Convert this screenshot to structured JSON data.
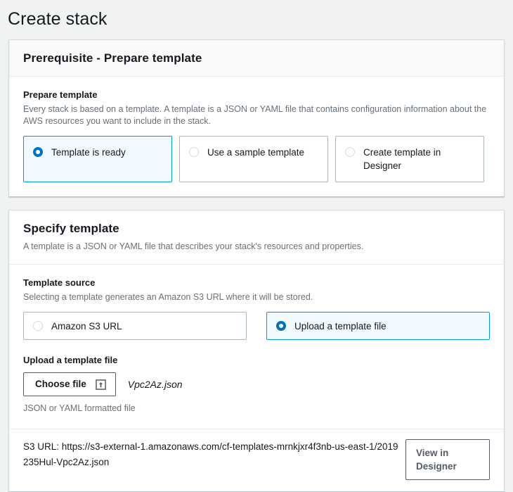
{
  "page": {
    "title": "Create stack"
  },
  "prerequisite": {
    "section_title": "Prerequisite - Prepare template",
    "field_label": "Prepare template",
    "field_desc": "Every stack is based on a template. A template is a JSON or YAML file that contains configuration information about the AWS resources you want to include in the stack.",
    "options": [
      {
        "label": "Template is ready",
        "selected": true
      },
      {
        "label": "Use a sample template",
        "selected": false
      },
      {
        "label": "Create template in Designer",
        "selected": false
      }
    ]
  },
  "specify_template": {
    "section_title": "Specify template",
    "section_subtitle": "A template is a JSON or YAML file that describes your stack's resources and properties.",
    "source_label": "Template source",
    "source_desc": "Selecting a template generates an Amazon S3 URL where it will be stored.",
    "source_options": [
      {
        "label": "Amazon S3 URL",
        "selected": false
      },
      {
        "label": "Upload a template file",
        "selected": true
      }
    ],
    "upload_label": "Upload a template file",
    "choose_file_label": "Choose file",
    "choose_file_icon": "upload-icon",
    "file_name": "Vpc2Az.json",
    "constraint_text": "JSON or YAML formatted file",
    "s3_url_label": "S3 URL:",
    "s3_url_value": "https://s3-external-1.amazonaws.com/cf-templates-mrnkjxr4f3nb-us-east-1/2019235Hul-Vpc2Az.json",
    "view_designer_label": "View in Designer"
  },
  "colors": {
    "page_background": "#f1f3f3",
    "card_background": "#ffffff",
    "card_border": "#d5dbdb",
    "selected_tile_border": "#00a1c9",
    "selected_tile_background": "#f1faff",
    "radio_selected": "#0073bb",
    "text_primary": "#16191f",
    "text_secondary": "#687078",
    "button_border": "#545b64"
  }
}
